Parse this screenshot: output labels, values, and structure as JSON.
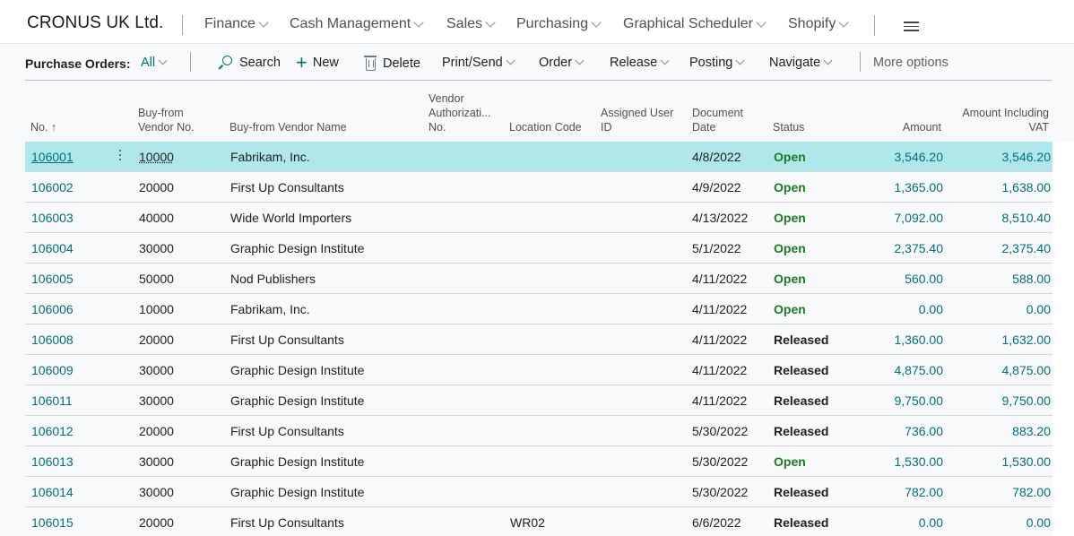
{
  "topbar": {
    "company": "CRONUS UK Ltd.",
    "nav": [
      {
        "label": "Finance"
      },
      {
        "label": "Cash Management"
      },
      {
        "label": "Sales"
      },
      {
        "label": "Purchasing"
      },
      {
        "label": "Graphical Scheduler"
      },
      {
        "label": "Shopify"
      }
    ],
    "menu_icon": "hamburger-icon"
  },
  "actionbar": {
    "title": "Purchase Orders:",
    "filter": "All",
    "actions": {
      "search": "Search",
      "new": "New",
      "delete": "Delete",
      "print_send": "Print/Send",
      "order": "Order",
      "release": "Release",
      "posting": "Posting",
      "navigate": "Navigate",
      "more": "More options"
    }
  },
  "table": {
    "columns": {
      "no": "No. ↑",
      "vendor_no": "Buy-from Vendor No.",
      "vendor_name": "Buy-from Vendor Name",
      "vendor_auth": "Vendor Authorizati... No.",
      "location": "Location Code",
      "assigned_user": "Assigned User ID",
      "doc_date": "Document Date",
      "status": "Status",
      "amount": "Amount",
      "amount_vat": "Amount Including VAT"
    },
    "rows": [
      {
        "no": "106001",
        "vendor_no": "10000",
        "vendor_name": "Fabrikam, Inc.",
        "vendor_auth": "",
        "location": "",
        "assigned_user": "",
        "doc_date": "4/8/2022",
        "status": "Open",
        "amount": "3,546.20",
        "amount_vat": "3,546.20",
        "selected": true
      },
      {
        "no": "106002",
        "vendor_no": "20000",
        "vendor_name": "First Up Consultants",
        "vendor_auth": "",
        "location": "",
        "assigned_user": "",
        "doc_date": "4/9/2022",
        "status": "Open",
        "amount": "1,365.00",
        "amount_vat": "1,638.00"
      },
      {
        "no": "106003",
        "vendor_no": "40000",
        "vendor_name": "Wide World Importers",
        "vendor_auth": "",
        "location": "",
        "assigned_user": "",
        "doc_date": "4/13/2022",
        "status": "Open",
        "amount": "7,092.00",
        "amount_vat": "8,510.40"
      },
      {
        "no": "106004",
        "vendor_no": "30000",
        "vendor_name": "Graphic Design Institute",
        "vendor_auth": "",
        "location": "",
        "assigned_user": "",
        "doc_date": "5/1/2022",
        "status": "Open",
        "amount": "2,375.40",
        "amount_vat": "2,375.40"
      },
      {
        "no": "106005",
        "vendor_no": "50000",
        "vendor_name": "Nod Publishers",
        "vendor_auth": "",
        "location": "",
        "assigned_user": "",
        "doc_date": "4/11/2022",
        "status": "Open",
        "amount": "560.00",
        "amount_vat": "588.00"
      },
      {
        "no": "106006",
        "vendor_no": "10000",
        "vendor_name": "Fabrikam, Inc.",
        "vendor_auth": "",
        "location": "",
        "assigned_user": "",
        "doc_date": "4/11/2022",
        "status": "Open",
        "amount": "0.00",
        "amount_vat": "0.00"
      },
      {
        "no": "106008",
        "vendor_no": "20000",
        "vendor_name": "First Up Consultants",
        "vendor_auth": "",
        "location": "",
        "assigned_user": "",
        "doc_date": "4/11/2022",
        "status": "Released",
        "amount": "1,360.00",
        "amount_vat": "1,632.00"
      },
      {
        "no": "106009",
        "vendor_no": "30000",
        "vendor_name": "Graphic Design Institute",
        "vendor_auth": "",
        "location": "",
        "assigned_user": "",
        "doc_date": "4/11/2022",
        "status": "Released",
        "amount": "4,875.00",
        "amount_vat": "4,875.00"
      },
      {
        "no": "106011",
        "vendor_no": "30000",
        "vendor_name": "Graphic Design Institute",
        "vendor_auth": "",
        "location": "",
        "assigned_user": "",
        "doc_date": "4/11/2022",
        "status": "Released",
        "amount": "9,750.00",
        "amount_vat": "9,750.00"
      },
      {
        "no": "106012",
        "vendor_no": "20000",
        "vendor_name": "First Up Consultants",
        "vendor_auth": "",
        "location": "",
        "assigned_user": "",
        "doc_date": "5/30/2022",
        "status": "Released",
        "amount": "736.00",
        "amount_vat": "883.20"
      },
      {
        "no": "106013",
        "vendor_no": "30000",
        "vendor_name": "Graphic Design Institute",
        "vendor_auth": "",
        "location": "",
        "assigned_user": "",
        "doc_date": "5/30/2022",
        "status": "Open",
        "amount": "1,530.00",
        "amount_vat": "1,530.00"
      },
      {
        "no": "106014",
        "vendor_no": "30000",
        "vendor_name": "Graphic Design Institute",
        "vendor_auth": "",
        "location": "",
        "assigned_user": "",
        "doc_date": "5/30/2022",
        "status": "Released",
        "amount": "782.00",
        "amount_vat": "782.00"
      },
      {
        "no": "106015",
        "vendor_no": "20000",
        "vendor_name": "First Up Consultants",
        "vendor_auth": "",
        "location": "WR02",
        "assigned_user": "",
        "doc_date": "6/6/2022",
        "status": "Released",
        "amount": "0.00",
        "amount_vat": "0.00"
      }
    ]
  },
  "colors": {
    "accent": "#00707a",
    "selected_row": "#b0e7ea",
    "status_open": "#1e7a1e",
    "status_released": "#212121"
  }
}
